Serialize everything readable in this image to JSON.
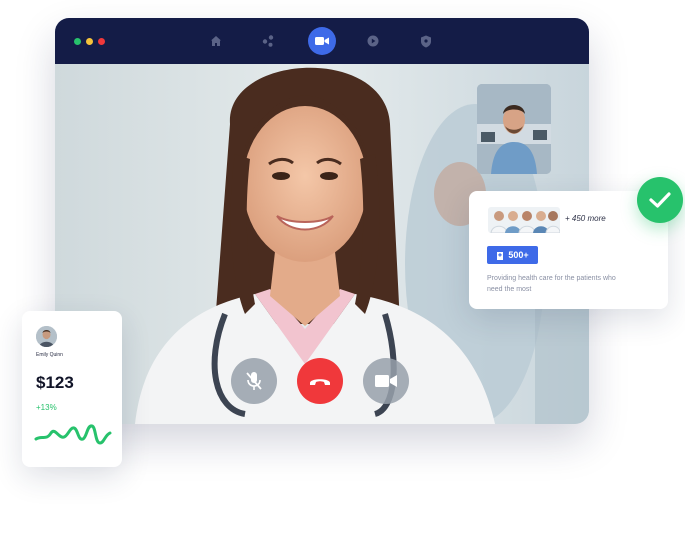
{
  "team_card": {
    "more_text": "+ 450 more",
    "badge_text": "500+",
    "description": "Providing health care for the patients who need the most"
  },
  "user_card": {
    "name": "Emily Quinn",
    "amount": "$123",
    "change": "+13%"
  },
  "colors": {
    "titlebar": "#141c47",
    "accent_blue": "#3e6ae8",
    "end_call_red": "#f0383b",
    "success_green": "#27c26c",
    "dots": [
      "#27c26c",
      "#f5c33b",
      "#f0383b"
    ]
  },
  "icons": {
    "nav": [
      "home-icon",
      "share-icon",
      "video-camera-icon",
      "play-icon",
      "shield-icon"
    ],
    "controls": [
      "mic-off-icon",
      "end-call-icon",
      "camera-icon"
    ]
  }
}
